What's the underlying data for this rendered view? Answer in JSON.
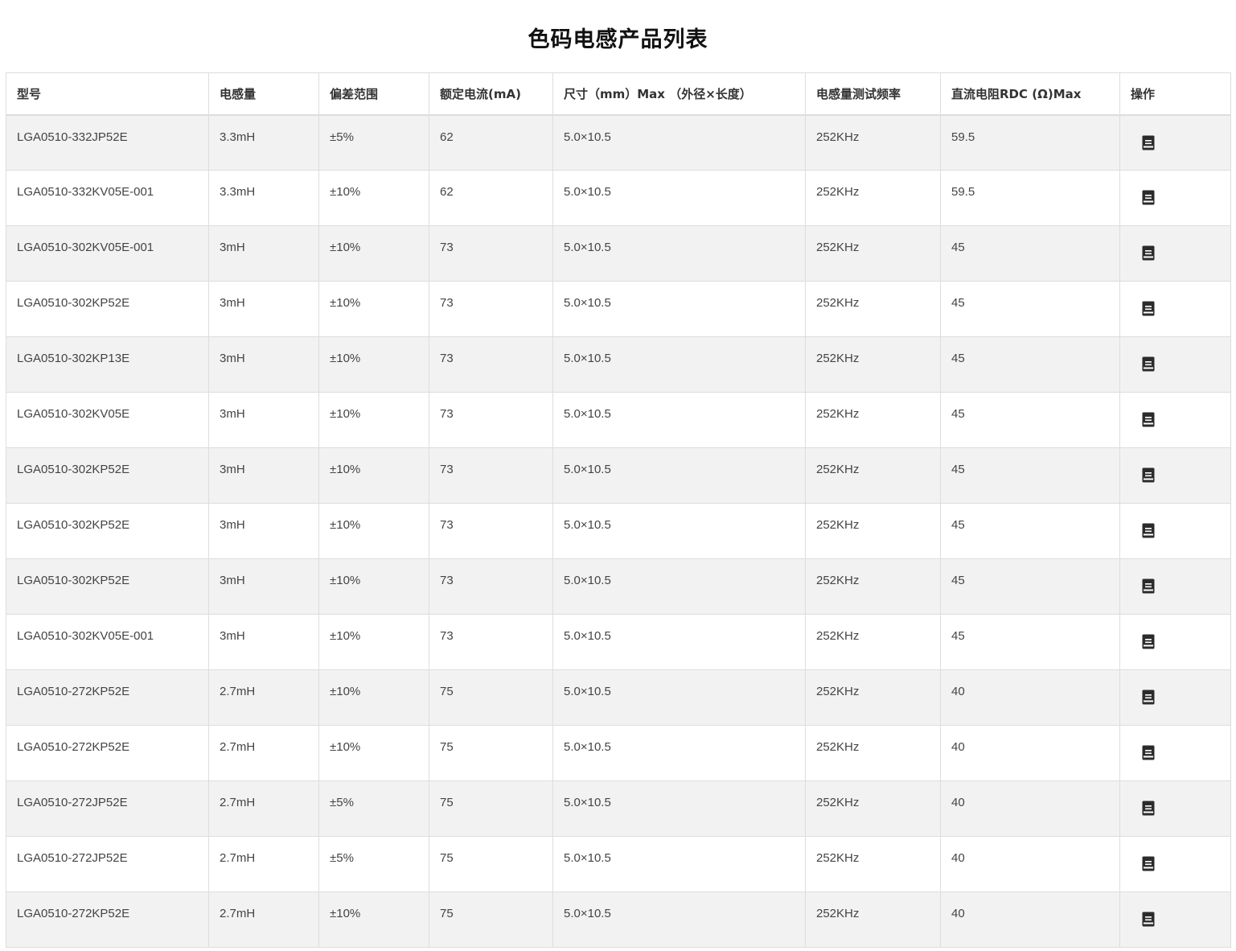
{
  "page_title": "色码电感产品列表",
  "table": {
    "headers": [
      "型号",
      "电感量",
      "偏差范围",
      "额定电流(mA)",
      "尺寸（mm）Max （外径×长度）",
      "电感量测试频率",
      "直流电阻RDC (Ω)Max",
      "操作"
    ],
    "rows": [
      {
        "model": "LGA0510-332JP52E",
        "inductance": "3.3mH",
        "tolerance": "±5%",
        "current": "62",
        "size": "5.0×10.5",
        "freq": "252KHz",
        "rdc": "59.5"
      },
      {
        "model": "LGA0510-332KV05E-001",
        "inductance": "3.3mH",
        "tolerance": "±10%",
        "current": "62",
        "size": "5.0×10.5",
        "freq": "252KHz",
        "rdc": "59.5"
      },
      {
        "model": "LGA0510-302KV05E-001",
        "inductance": "3mH",
        "tolerance": "±10%",
        "current": "73",
        "size": "5.0×10.5",
        "freq": "252KHz",
        "rdc": "45"
      },
      {
        "model": "LGA0510-302KP52E",
        "inductance": "3mH",
        "tolerance": "±10%",
        "current": "73",
        "size": "5.0×10.5",
        "freq": "252KHz",
        "rdc": "45"
      },
      {
        "model": "LGA0510-302KP13E",
        "inductance": "3mH",
        "tolerance": "±10%",
        "current": "73",
        "size": "5.0×10.5",
        "freq": "252KHz",
        "rdc": "45"
      },
      {
        "model": "LGA0510-302KV05E",
        "inductance": "3mH",
        "tolerance": "±10%",
        "current": "73",
        "size": "5.0×10.5",
        "freq": "252KHz",
        "rdc": "45"
      },
      {
        "model": "LGA0510-302KP52E",
        "inductance": "3mH",
        "tolerance": "±10%",
        "current": "73",
        "size": "5.0×10.5",
        "freq": "252KHz",
        "rdc": "45"
      },
      {
        "model": "LGA0510-302KP52E",
        "inductance": "3mH",
        "tolerance": "±10%",
        "current": "73",
        "size": "5.0×10.5",
        "freq": "252KHz",
        "rdc": "45"
      },
      {
        "model": "LGA0510-302KP52E",
        "inductance": "3mH",
        "tolerance": "±10%",
        "current": "73",
        "size": "5.0×10.5",
        "freq": "252KHz",
        "rdc": "45"
      },
      {
        "model": "LGA0510-302KV05E-001",
        "inductance": "3mH",
        "tolerance": "±10%",
        "current": "73",
        "size": "5.0×10.5",
        "freq": "252KHz",
        "rdc": "45"
      },
      {
        "model": "LGA0510-272KP52E",
        "inductance": "2.7mH",
        "tolerance": "±10%",
        "current": "75",
        "size": "5.0×10.5",
        "freq": "252KHz",
        "rdc": "40"
      },
      {
        "model": "LGA0510-272KP52E",
        "inductance": "2.7mH",
        "tolerance": "±10%",
        "current": "75",
        "size": "5.0×10.5",
        "freq": "252KHz",
        "rdc": "40"
      },
      {
        "model": "LGA0510-272JP52E",
        "inductance": "2.7mH",
        "tolerance": "±5%",
        "current": "75",
        "size": "5.0×10.5",
        "freq": "252KHz",
        "rdc": "40"
      },
      {
        "model": "LGA0510-272JP52E",
        "inductance": "2.7mH",
        "tolerance": "±5%",
        "current": "75",
        "size": "5.0×10.5",
        "freq": "252KHz",
        "rdc": "40"
      },
      {
        "model": "LGA0510-272KP52E",
        "inductance": "2.7mH",
        "tolerance": "±10%",
        "current": "75",
        "size": "5.0×10.5",
        "freq": "252KHz",
        "rdc": "40"
      }
    ],
    "action_icon": "document-icon"
  },
  "colors": {
    "stripe": "#f2f2f2",
    "border": "#dddddd",
    "icon": "#2b2b2b"
  }
}
